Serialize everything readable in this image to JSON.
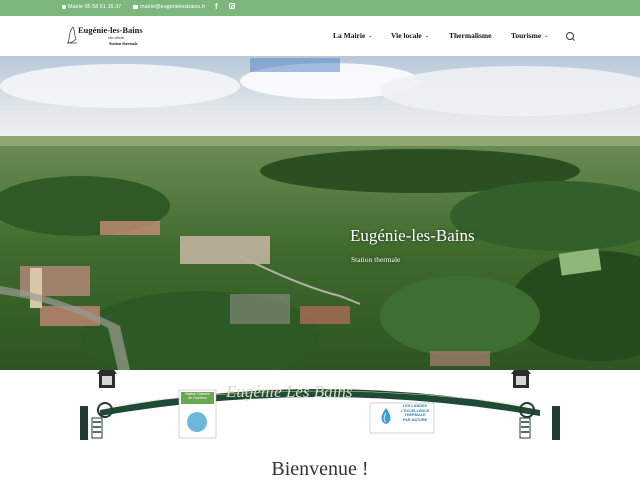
{
  "topbar": {
    "phone": "Mairie 05 58 51 15 37",
    "email": "mairie@eugenielesbains.fr",
    "facebook_icon": "facebook-icon",
    "instagram_icon": "instagram-icon",
    "bg_color": "#7cb87c"
  },
  "header": {
    "logo_name": "Eugénie-les-Bains",
    "logo_sub": "site officiel",
    "logo_sub2": "Station thermale",
    "nav": [
      {
        "label": "La Mairie",
        "has_dropdown": true
      },
      {
        "label": "Vie locale",
        "has_dropdown": true
      },
      {
        "label": "Thermalisme",
        "has_dropdown": false
      },
      {
        "label": "Tourisme",
        "has_dropdown": true
      }
    ],
    "search_icon": "search-icon"
  },
  "hero": {
    "title": "Eugénie-les-Bains",
    "subtitle": "Station thermale"
  },
  "banner": {
    "sign_text": "Eugénie Les Bains",
    "badge_left_line1": "Station Classée",
    "badge_left_line2": "de Tourisme",
    "badge_right_line1": "LES LANDES",
    "badge_right_line2": "L'EXCELLENCE",
    "badge_right_line3": "THERMALE",
    "badge_right_line4": "PAR NATURE"
  },
  "main": {
    "heading": "Bienvenue !"
  }
}
